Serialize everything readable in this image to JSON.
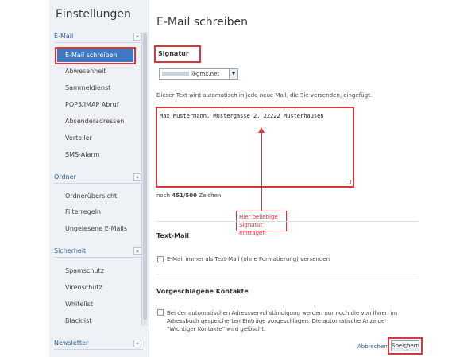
{
  "sidebar": {
    "title": "Einstellungen",
    "sections": [
      {
        "title": "E-Mail",
        "items": [
          "E-Mail schreiben",
          "Abwesenheit",
          "Sammeldienst",
          "POP3/IMAP Abruf",
          "Absenderadressen",
          "Verteiler",
          "SMS-Alarm"
        ]
      },
      {
        "title": "Ordner",
        "items": [
          "Ordnerübersicht",
          "Filterregeln",
          "Ungelesene E-Mails"
        ]
      },
      {
        "title": "Sicherheit",
        "items": [
          "Spamschutz",
          "Virenschutz",
          "Whitelist",
          "Blacklist"
        ]
      },
      {
        "title": "Newsletter",
        "items": []
      }
    ],
    "collapse_glyph": "«"
  },
  "main": {
    "title": "E-Mail schreiben",
    "signature": {
      "heading": "Signatur",
      "email_domain": "@gmx.net",
      "description": "Dieser Text wird automatisch in jede neue Mail, die Sie versenden, eingefügt.",
      "text": "Max Mustermann, Mustergasse 2, 22222 Musterhausen",
      "count_prefix": "noch",
      "count_value": "451/500",
      "count_suffix": "Zeichen"
    },
    "annotation": {
      "line1": "Hier beliebige",
      "line2": "Signatur eintragen"
    },
    "textmail": {
      "heading": "Text-Mail",
      "label": "E-Mail immer als Text-Mail (ohne Formatierung) versenden"
    },
    "contacts": {
      "heading": "Vorgeschlagene Kontakte",
      "label": "Bei der automatischen Adressvervollständigung werden nur noch die von Ihnen im Adressbuch gespeicherten Einträge vorgeschlagen. Die automatische Anzeige \"Wichtiger Kontakte\" wird gelöscht."
    },
    "actions": {
      "cancel": "Abbrechen",
      "save": "Speichern"
    }
  }
}
